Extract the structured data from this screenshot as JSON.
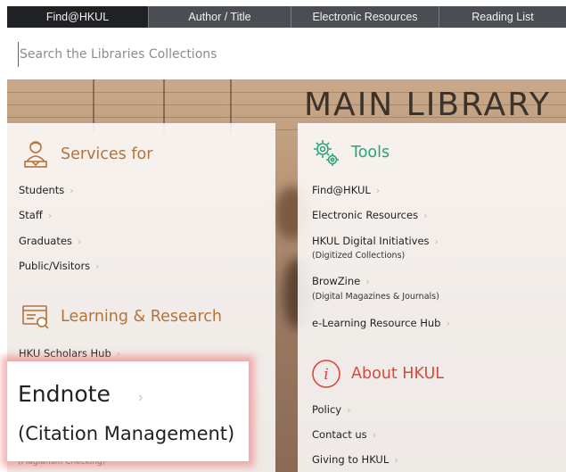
{
  "tabs": [
    "Find@HKUL",
    "Author / Title",
    "Electronic Resources",
    "Reading List"
  ],
  "search": {
    "placeholder": "Search the Libraries Collections"
  },
  "hero": {
    "title": "MAIN LIBRARY"
  },
  "services": {
    "heading": "Services for",
    "icon": "librarian-icon",
    "items": [
      "Students",
      "Staff",
      "Graduates",
      "Public/Visitors"
    ]
  },
  "learning": {
    "heading": "Learning & Research",
    "icon": "monitor-search-icon",
    "items": [
      "HKU Scholars Hub"
    ]
  },
  "tools": {
    "heading": "Tools",
    "icon": "gears-icon",
    "items": [
      {
        "label": "Find@HKUL",
        "sub": ""
      },
      {
        "label": "Electronic Resources",
        "sub": ""
      },
      {
        "label": "HKUL Digital Initiatives",
        "sub": "(Digitized Collections)"
      },
      {
        "label": "BrowZine",
        "sub": "(Digital Magazines & Journals)"
      },
      {
        "label": "e-Learning Resource Hub",
        "sub": ""
      }
    ]
  },
  "about": {
    "heading": "About HKUL",
    "icon": "info-icon",
    "items": [
      "Policy",
      "Contact us",
      "Giving to HKUL"
    ]
  },
  "callout": {
    "title": "Endnote",
    "subtitle": "(Citation Management)",
    "peek": "(Plagiarism Checking)"
  },
  "colors": {
    "tab_active": "#1f2124",
    "tab_bar": "#4a4e52",
    "orange": "#b5733a",
    "green": "#2aa37a",
    "red": "#d9483b"
  }
}
